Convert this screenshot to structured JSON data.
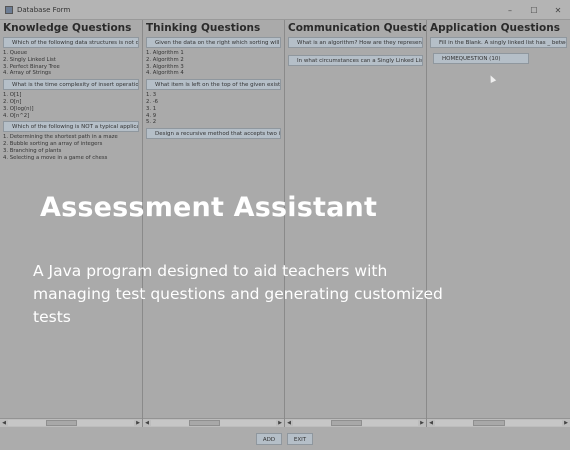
{
  "window": {
    "title": "Database Form",
    "controls": [
      "–",
      "☐",
      "✕"
    ]
  },
  "columns": [
    {
      "heading": "Knowledge Questions",
      "blocks": [
        {
          "question": "Which of the following data structures is not dyn",
          "answers": [
            "1. Queue",
            "2. Singly Linked List",
            "3. Perfect Binary Tree",
            "4. Array of Strings"
          ]
        },
        {
          "question": "What is the time complexity of insert operation on",
          "answers": [
            "1. O[1]",
            "2. O[n]",
            "3. O[log(n)]",
            "4. O[n^2]"
          ]
        },
        {
          "question": "Which of the following is NOT a typical applicatio",
          "answers": [
            "1. Determining the shortest path in a maze",
            "2. Bubble sorting an array of integers",
            "3. Branching of plants",
            "4. Selecting a move in a game of chess"
          ]
        }
      ]
    },
    {
      "heading": "Thinking Questions",
      "blocks": [
        {
          "question": "Given the data on the right which sorting will be",
          "answers": [
            "1. Algorithm 1",
            "2. Algorithm 2",
            "3. Algorithm 3",
            "4. Algorithm 4"
          ]
        },
        {
          "question": "What item is left on the top of the given existing",
          "answers": [
            "1. 3",
            "2. -6",
            "3. 1",
            "4. 9",
            "5. 2"
          ]
        },
        {
          "question": "Design a recursive method that accepts two inte",
          "answers": []
        }
      ]
    },
    {
      "heading": "Communication Questions",
      "blocks": [
        {
          "question": "What is an algorithm? How are they represented?",
          "answers": []
        },
        {
          "question": "In what circumstances can a Singly Linked List o",
          "answers": []
        }
      ]
    },
    {
      "heading": "Application Questions",
      "blocks": [
        {
          "question": "Fill in the Blank. A singly linked list has _ betwee",
          "answers": []
        },
        {
          "question": "HOMEQUESTION (10)",
          "answers": []
        }
      ]
    }
  ],
  "buttons": {
    "add": "ADD",
    "exit": "EXIT"
  },
  "overlay": {
    "title": "Assessment Assistant",
    "description": "A Java program designed to aid teachers with managing test questions and generating customized tests"
  }
}
